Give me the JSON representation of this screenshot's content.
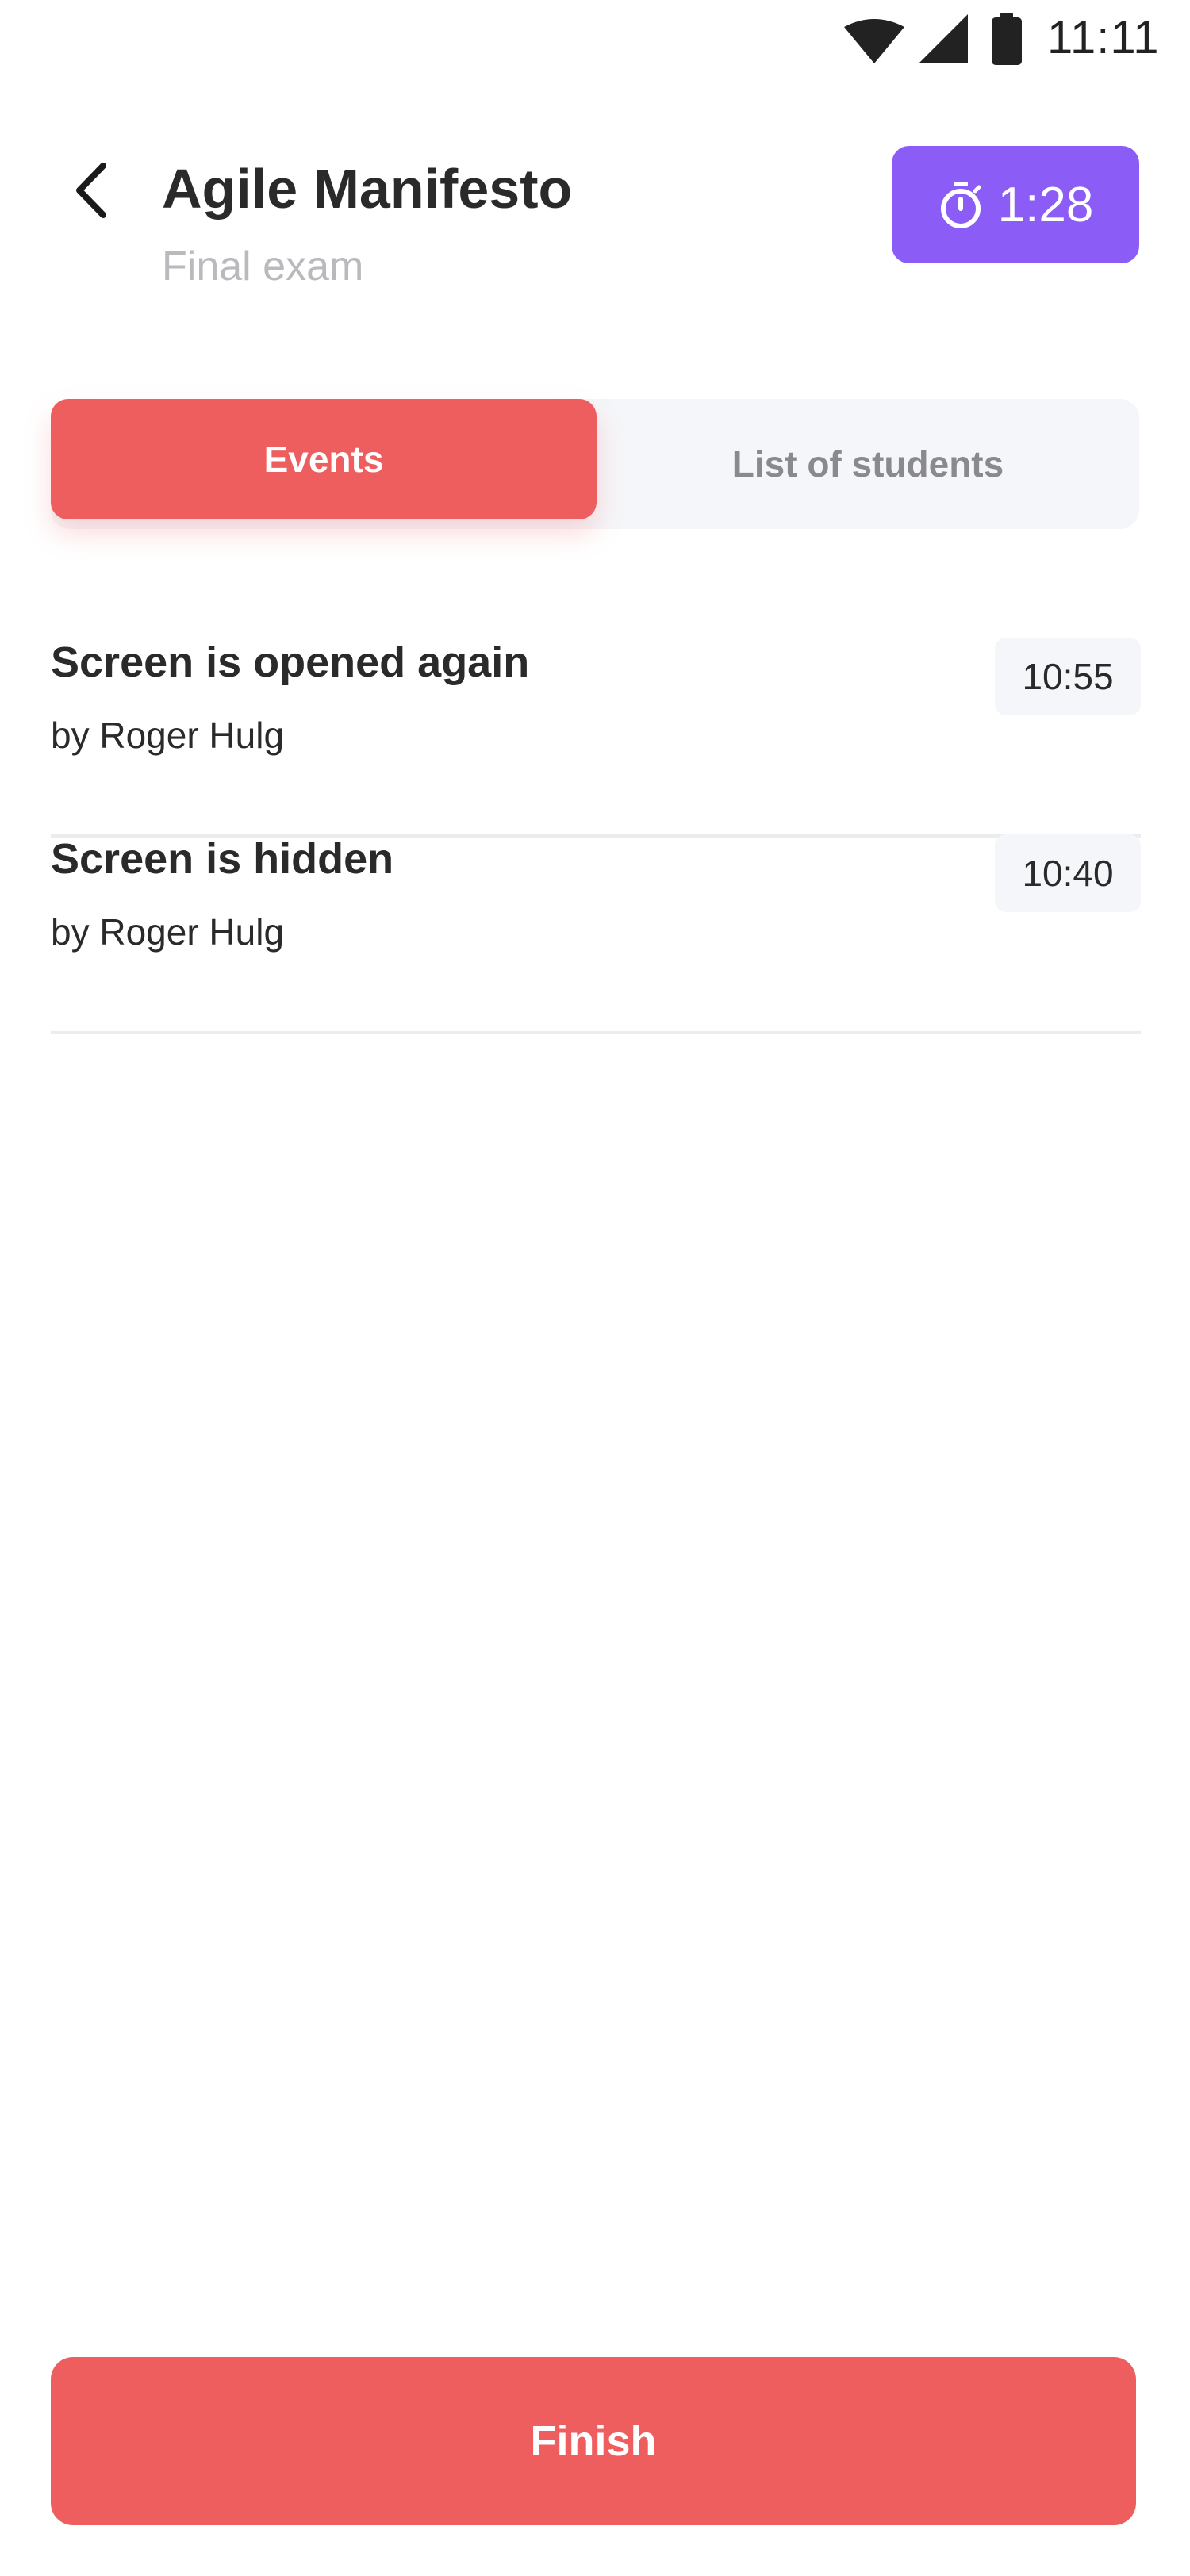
{
  "status_bar": {
    "time": "11:11",
    "icons": [
      "wifi-icon",
      "signal-icon",
      "battery-icon"
    ]
  },
  "header": {
    "back_icon": "chevron-left-icon",
    "title": "Agile Manifesto",
    "subtitle": "Final exam",
    "timer": {
      "icon": "stopwatch-icon",
      "value": "1:28",
      "color": "#8b5cf6"
    }
  },
  "tabs": [
    {
      "label": "Events",
      "active": true
    },
    {
      "label": "List of students",
      "active": false
    }
  ],
  "events": [
    {
      "title": "Screen is opened again",
      "by": "by Roger Hulg",
      "time": "10:55"
    },
    {
      "title": "Screen is hidden",
      "by": "by Roger Hulg",
      "time": "10:40"
    }
  ],
  "finish_label": "Finish",
  "colors": {
    "accent": "#ee5e5e",
    "timer": "#8b5cf6",
    "muted": "#f5f6f9"
  }
}
